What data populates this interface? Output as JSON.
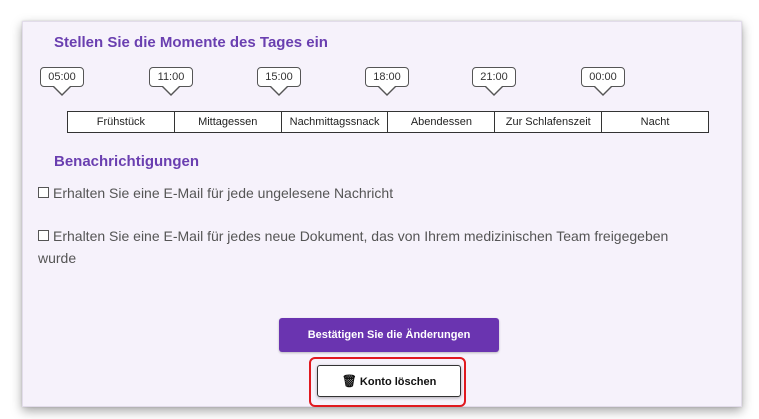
{
  "moments": {
    "title": "Stellen Sie die Momente des Tages ein",
    "times": [
      "05:00",
      "11:00",
      "15:00",
      "18:00",
      "21:00",
      "00:00"
    ],
    "periods": [
      "Frühstück",
      "Mittagessen",
      "Nachmittagssnack",
      "Abendessen",
      "Zur Schlafenszeit",
      "Nacht"
    ]
  },
  "notifications": {
    "title": "Benachrichtigungen",
    "options": [
      {
        "label": "Erhalten Sie eine E-Mail für jede ungelesene Nachricht",
        "checked": false
      },
      {
        "label": "Erhalten Sie eine E-Mail für jedes neue Dokument, das von Ihrem medizinischen Team freigegeben wurde",
        "checked": false
      }
    ]
  },
  "actions": {
    "confirm_label": "Bestätigen Sie die Änderungen",
    "delete_label": "Konto löschen",
    "delete_icon": "trash-icon"
  },
  "colors": {
    "accent": "#6a34b0",
    "highlight": "#e0191f",
    "card_bg": "#f6f2fb"
  }
}
